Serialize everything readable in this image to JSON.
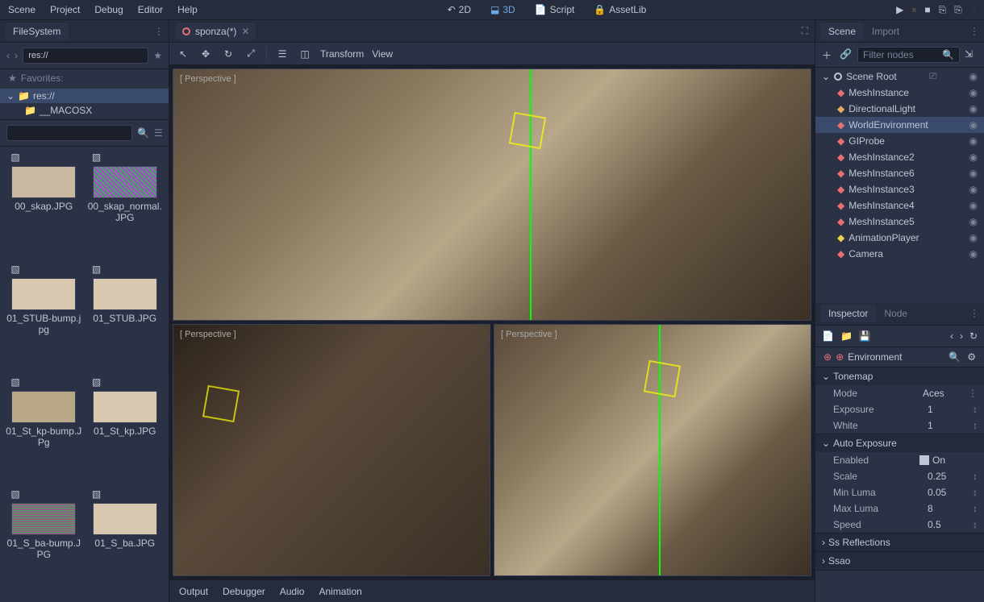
{
  "menubar": {
    "items": [
      "Scene",
      "Project",
      "Debug",
      "Editor",
      "Help"
    ],
    "center": [
      {
        "icon": "↶",
        "label": "2D"
      },
      {
        "icon": "⬓",
        "label": "3D",
        "active": true
      },
      {
        "icon": "📄",
        "label": "Script"
      },
      {
        "icon": "🔒",
        "label": "AssetLib"
      }
    ]
  },
  "filesystem": {
    "tab": "FileSystem",
    "path": "res://",
    "favorites": "Favorites:",
    "tree": [
      {
        "label": "res://",
        "sel": true,
        "indent": 0,
        "icon": "📁"
      },
      {
        "label": "__MACOSX",
        "indent": 1,
        "icon": "📁"
      }
    ],
    "assets": [
      {
        "name": "00_skap.JPG"
      },
      {
        "name": "00_skap_normal.JPG"
      },
      {
        "name": "01_STUB-bump.jpg"
      },
      {
        "name": "01_STUB.JPG"
      },
      {
        "name": "01_St_kp-bump.JPg"
      },
      {
        "name": "01_St_kp.JPG"
      },
      {
        "name": "01_S_ba-bump.JPG"
      },
      {
        "name": "01_S_ba.JPG"
      }
    ]
  },
  "scene_tab": {
    "name": "sponza(*)"
  },
  "viewport_toolbar": {
    "transform": "Transform",
    "view": "View"
  },
  "viewport_label": "[ Perspective ]",
  "bottom_panels": [
    "Output",
    "Debugger",
    "Audio",
    "Animation"
  ],
  "scene_panel": {
    "tabs": [
      "Scene",
      "Import"
    ],
    "filter_placeholder": "Filter nodes",
    "root": "Scene Root",
    "nodes": [
      {
        "name": "MeshInstance",
        "icon": "mesh",
        "color": "#e87070"
      },
      {
        "name": "DirectionalLight",
        "icon": "light",
        "color": "#e8a860"
      },
      {
        "name": "WorldEnvironment",
        "icon": "env",
        "color": "#e87070",
        "sel": true
      },
      {
        "name": "GIProbe",
        "icon": "probe",
        "color": "#e87070"
      },
      {
        "name": "MeshInstance2",
        "icon": "mesh",
        "color": "#e87070"
      },
      {
        "name": "MeshInstance6",
        "icon": "mesh",
        "color": "#e87070"
      },
      {
        "name": "MeshInstance3",
        "icon": "mesh",
        "color": "#e87070"
      },
      {
        "name": "MeshInstance4",
        "icon": "mesh",
        "color": "#e87070"
      },
      {
        "name": "MeshInstance5",
        "icon": "mesh",
        "color": "#e87070"
      },
      {
        "name": "AnimationPlayer",
        "icon": "anim",
        "color": "#e8d050"
      },
      {
        "name": "Camera",
        "icon": "cam",
        "color": "#e87070"
      }
    ]
  },
  "inspector": {
    "tabs": [
      "Inspector",
      "Node"
    ],
    "type": "Environment",
    "sections": [
      {
        "name": "Tonemap",
        "open": true,
        "props": [
          {
            "name": "Mode",
            "value": "Aces",
            "spin": "⋮"
          },
          {
            "name": "Exposure",
            "value": "1",
            "spin": "↕"
          },
          {
            "name": "White",
            "value": "1",
            "spin": "↕"
          }
        ]
      },
      {
        "name": "Auto Exposure",
        "open": true,
        "props": [
          {
            "name": "Enabled",
            "value": "On",
            "check": true
          },
          {
            "name": "Scale",
            "value": "0.25",
            "spin": "↕"
          },
          {
            "name": "Min Luma",
            "value": "0.05",
            "spin": "↕"
          },
          {
            "name": "Max Luma",
            "value": "8",
            "spin": "↕"
          },
          {
            "name": "Speed",
            "value": "0.5",
            "spin": "↕"
          }
        ]
      },
      {
        "name": "Ss Reflections",
        "open": false
      },
      {
        "name": "Ssao",
        "open": false
      }
    ]
  }
}
